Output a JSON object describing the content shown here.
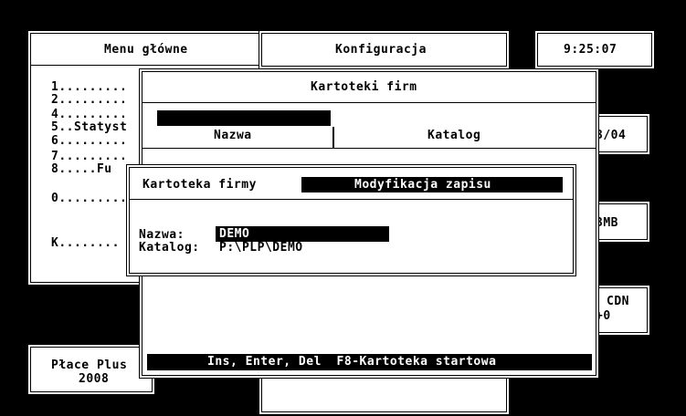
{
  "top": {
    "menu_title": "Menu główne",
    "config_title": "Konfiguracja",
    "clock": "9:25:07"
  },
  "menu": {
    "items": [
      "1.........",
      "2.........",
      "4.........",
      "5..Statyst",
      "6.........",
      "7.........",
      "8.....Fu",
      "0.........",
      "K........"
    ]
  },
  "right_panels": {
    "date": "3/04",
    "memory": "3MB",
    "cdn_label": "CDN",
    "cdn_value": "+0"
  },
  "product": {
    "name": "Płace Plus",
    "year": "2008"
  },
  "kartoteki": {
    "title": "Kartoteki firm",
    "col_name": "Nazwa",
    "col_catalog": "Katalog",
    "footer": "Ins, Enter, Del  F8-Kartoteka startowa"
  },
  "dialog": {
    "title": "Kartoteka firmy",
    "mode": "Modyfikacja zapisu",
    "name_label": "Nazwa:",
    "name_value": "DEMO",
    "catalog_label": "Katalog:",
    "catalog_value": "P:\\PLP\\DEMO"
  }
}
